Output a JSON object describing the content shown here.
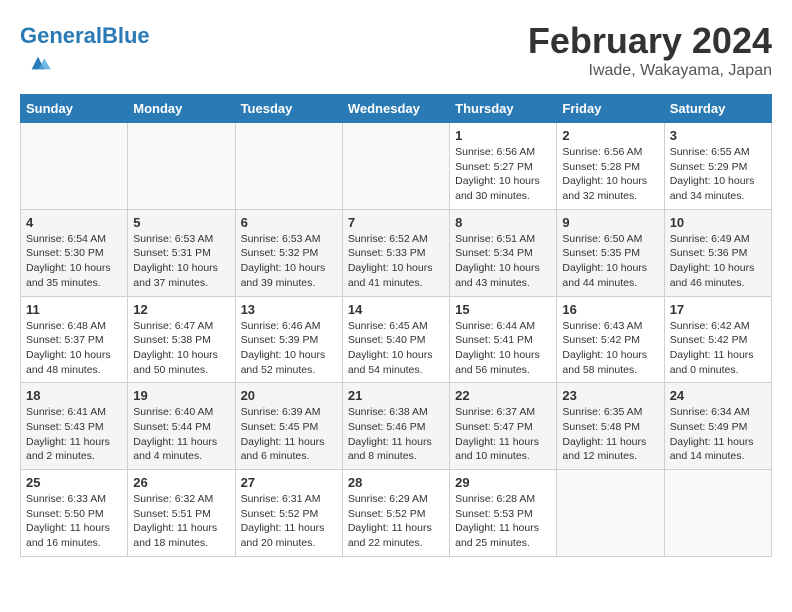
{
  "header": {
    "logo_general": "General",
    "logo_blue": "Blue",
    "month_title": "February 2024",
    "location": "Iwade, Wakayama, Japan"
  },
  "weekdays": [
    "Sunday",
    "Monday",
    "Tuesday",
    "Wednesday",
    "Thursday",
    "Friday",
    "Saturday"
  ],
  "weeks": [
    [
      {
        "day": "",
        "info": ""
      },
      {
        "day": "",
        "info": ""
      },
      {
        "day": "",
        "info": ""
      },
      {
        "day": "",
        "info": ""
      },
      {
        "day": "1",
        "info": "Sunrise: 6:56 AM\nSunset: 5:27 PM\nDaylight: 10 hours\nand 30 minutes."
      },
      {
        "day": "2",
        "info": "Sunrise: 6:56 AM\nSunset: 5:28 PM\nDaylight: 10 hours\nand 32 minutes."
      },
      {
        "day": "3",
        "info": "Sunrise: 6:55 AM\nSunset: 5:29 PM\nDaylight: 10 hours\nand 34 minutes."
      }
    ],
    [
      {
        "day": "4",
        "info": "Sunrise: 6:54 AM\nSunset: 5:30 PM\nDaylight: 10 hours\nand 35 minutes."
      },
      {
        "day": "5",
        "info": "Sunrise: 6:53 AM\nSunset: 5:31 PM\nDaylight: 10 hours\nand 37 minutes."
      },
      {
        "day": "6",
        "info": "Sunrise: 6:53 AM\nSunset: 5:32 PM\nDaylight: 10 hours\nand 39 minutes."
      },
      {
        "day": "7",
        "info": "Sunrise: 6:52 AM\nSunset: 5:33 PM\nDaylight: 10 hours\nand 41 minutes."
      },
      {
        "day": "8",
        "info": "Sunrise: 6:51 AM\nSunset: 5:34 PM\nDaylight: 10 hours\nand 43 minutes."
      },
      {
        "day": "9",
        "info": "Sunrise: 6:50 AM\nSunset: 5:35 PM\nDaylight: 10 hours\nand 44 minutes."
      },
      {
        "day": "10",
        "info": "Sunrise: 6:49 AM\nSunset: 5:36 PM\nDaylight: 10 hours\nand 46 minutes."
      }
    ],
    [
      {
        "day": "11",
        "info": "Sunrise: 6:48 AM\nSunset: 5:37 PM\nDaylight: 10 hours\nand 48 minutes."
      },
      {
        "day": "12",
        "info": "Sunrise: 6:47 AM\nSunset: 5:38 PM\nDaylight: 10 hours\nand 50 minutes."
      },
      {
        "day": "13",
        "info": "Sunrise: 6:46 AM\nSunset: 5:39 PM\nDaylight: 10 hours\nand 52 minutes."
      },
      {
        "day": "14",
        "info": "Sunrise: 6:45 AM\nSunset: 5:40 PM\nDaylight: 10 hours\nand 54 minutes."
      },
      {
        "day": "15",
        "info": "Sunrise: 6:44 AM\nSunset: 5:41 PM\nDaylight: 10 hours\nand 56 minutes."
      },
      {
        "day": "16",
        "info": "Sunrise: 6:43 AM\nSunset: 5:42 PM\nDaylight: 10 hours\nand 58 minutes."
      },
      {
        "day": "17",
        "info": "Sunrise: 6:42 AM\nSunset: 5:42 PM\nDaylight: 11 hours\nand 0 minutes."
      }
    ],
    [
      {
        "day": "18",
        "info": "Sunrise: 6:41 AM\nSunset: 5:43 PM\nDaylight: 11 hours\nand 2 minutes."
      },
      {
        "day": "19",
        "info": "Sunrise: 6:40 AM\nSunset: 5:44 PM\nDaylight: 11 hours\nand 4 minutes."
      },
      {
        "day": "20",
        "info": "Sunrise: 6:39 AM\nSunset: 5:45 PM\nDaylight: 11 hours\nand 6 minutes."
      },
      {
        "day": "21",
        "info": "Sunrise: 6:38 AM\nSunset: 5:46 PM\nDaylight: 11 hours\nand 8 minutes."
      },
      {
        "day": "22",
        "info": "Sunrise: 6:37 AM\nSunset: 5:47 PM\nDaylight: 11 hours\nand 10 minutes."
      },
      {
        "day": "23",
        "info": "Sunrise: 6:35 AM\nSunset: 5:48 PM\nDaylight: 11 hours\nand 12 minutes."
      },
      {
        "day": "24",
        "info": "Sunrise: 6:34 AM\nSunset: 5:49 PM\nDaylight: 11 hours\nand 14 minutes."
      }
    ],
    [
      {
        "day": "25",
        "info": "Sunrise: 6:33 AM\nSunset: 5:50 PM\nDaylight: 11 hours\nand 16 minutes."
      },
      {
        "day": "26",
        "info": "Sunrise: 6:32 AM\nSunset: 5:51 PM\nDaylight: 11 hours\nand 18 minutes."
      },
      {
        "day": "27",
        "info": "Sunrise: 6:31 AM\nSunset: 5:52 PM\nDaylight: 11 hours\nand 20 minutes."
      },
      {
        "day": "28",
        "info": "Sunrise: 6:29 AM\nSunset: 5:52 PM\nDaylight: 11 hours\nand 22 minutes."
      },
      {
        "day": "29",
        "info": "Sunrise: 6:28 AM\nSunset: 5:53 PM\nDaylight: 11 hours\nand 25 minutes."
      },
      {
        "day": "",
        "info": ""
      },
      {
        "day": "",
        "info": ""
      }
    ]
  ]
}
